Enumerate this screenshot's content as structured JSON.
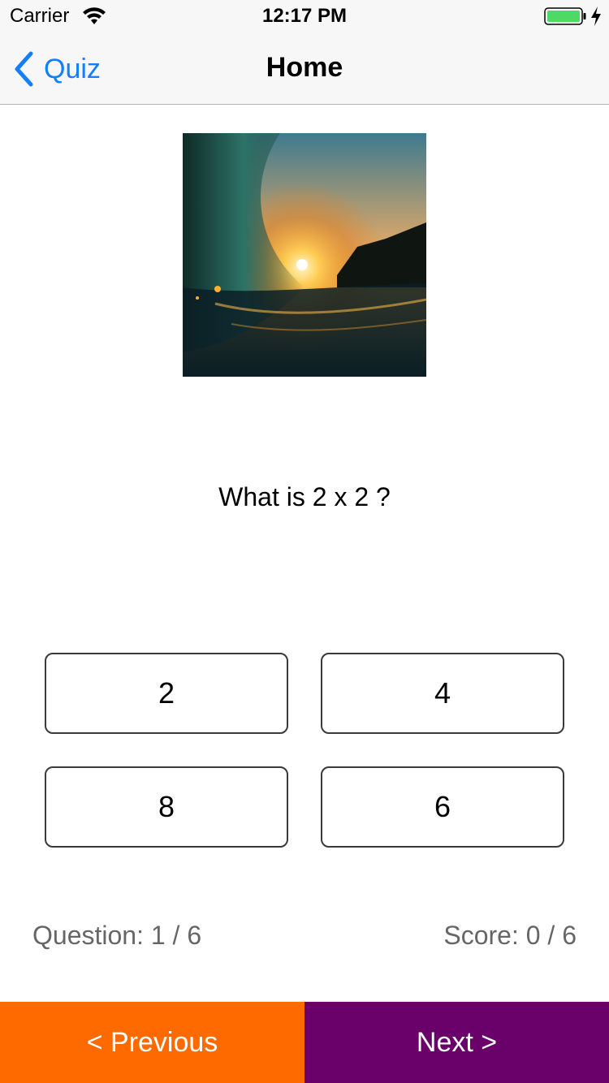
{
  "status_bar": {
    "carrier": "Carrier",
    "time": "12:17 PM",
    "battery_color": "#4cd964"
  },
  "nav": {
    "back_label": "Quiz",
    "title": "Home",
    "accent_color": "#147efb"
  },
  "quiz": {
    "image_icon": "ocean-wave-sunset-photo",
    "question": "What is 2 x 2 ?",
    "answers": [
      "2",
      "4",
      "8",
      "6"
    ],
    "question_progress": "Question: 1 / 6",
    "score": "Score: 0 / 6"
  },
  "footer": {
    "previous_label": "< Previous",
    "next_label": "Next >",
    "previous_color": "#ff6a00",
    "next_color": "#6a006a"
  }
}
